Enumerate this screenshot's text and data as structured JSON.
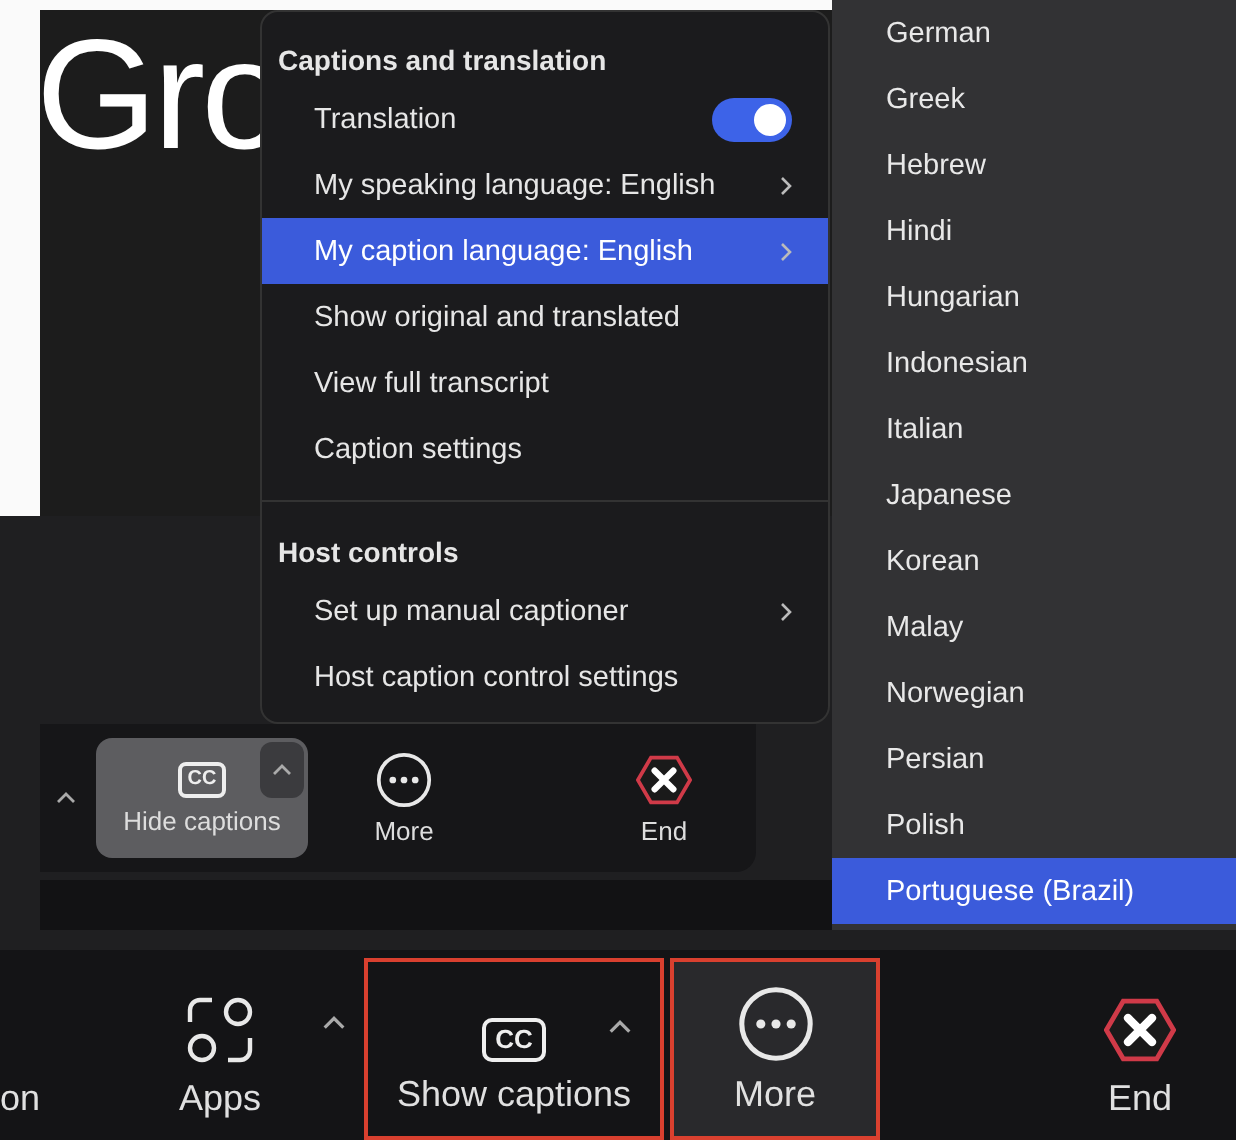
{
  "slide": {
    "title": "Gro"
  },
  "meeting_toolbar": {
    "items": [
      {
        "kind": "captions",
        "label": "Hide captions",
        "icon_text": "CC",
        "selected": true
      },
      {
        "kind": "more",
        "label": "More",
        "selected": false
      },
      {
        "kind": "end",
        "label": "End",
        "selected": false
      }
    ]
  },
  "captions_menu": {
    "sections": [
      {
        "heading": "Captions and translation",
        "items": [
          {
            "kind": "toggle",
            "label": "Translation",
            "on": true,
            "selected": false
          },
          {
            "kind": "submenu",
            "label": "My speaking language: English",
            "selected": false
          },
          {
            "kind": "submenu",
            "label": "My caption language: English",
            "selected": true
          },
          {
            "kind": "item",
            "label": "Show original and translated",
            "selected": false
          },
          {
            "kind": "item",
            "label": "View full transcript",
            "selected": false
          },
          {
            "kind": "item",
            "label": "Caption settings",
            "selected": false
          }
        ]
      },
      {
        "heading": "Host controls",
        "items": [
          {
            "kind": "submenu",
            "label": "Set up manual captioner",
            "selected": false
          },
          {
            "kind": "item",
            "label": "Host caption control settings",
            "selected": false
          }
        ]
      }
    ]
  },
  "language_menu": {
    "items": [
      {
        "label": "German",
        "selected": false
      },
      {
        "label": "Greek",
        "selected": false
      },
      {
        "label": "Hebrew",
        "selected": false
      },
      {
        "label": "Hindi",
        "selected": false
      },
      {
        "label": "Hungarian",
        "selected": false
      },
      {
        "label": "Indonesian",
        "selected": false
      },
      {
        "label": "Italian",
        "selected": false
      },
      {
        "label": "Japanese",
        "selected": false
      },
      {
        "label": "Korean",
        "selected": false
      },
      {
        "label": "Malay",
        "selected": false
      },
      {
        "label": "Norwegian",
        "selected": false
      },
      {
        "label": "Persian",
        "selected": false
      },
      {
        "label": "Polish",
        "selected": false
      },
      {
        "label": "Portuguese (Brazil)",
        "selected": true
      }
    ]
  },
  "bottom_toolbar": {
    "items": [
      {
        "kind": "text",
        "label": "on"
      },
      {
        "kind": "apps",
        "label": "Apps",
        "caret": true,
        "highlighted": false,
        "hovered": false
      },
      {
        "kind": "captions",
        "label": "Show captions",
        "icon_text": "CC",
        "caret": true,
        "highlighted": true,
        "hovered": false
      },
      {
        "kind": "more",
        "label": "More",
        "caret": false,
        "highlighted": true,
        "hovered": true
      },
      {
        "kind": "end",
        "label": "End",
        "caret": false,
        "highlighted": false,
        "hovered": false
      }
    ]
  }
}
